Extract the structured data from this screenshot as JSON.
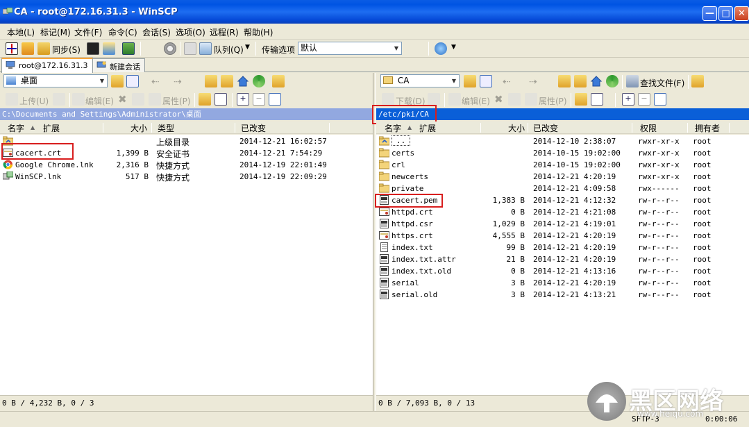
{
  "window": {
    "title": "CA - root@172.16.31.3 - WinSCP"
  },
  "menu": [
    "本地(L)",
    "标记(M)",
    "文件(F)",
    "命令(C)",
    "会话(S)",
    "选项(O)",
    "远程(R)",
    "帮助(H)"
  ],
  "toolbar": {
    "sync_label": "同步(S)",
    "queue_label": "队列(Q)",
    "transfer_label": "传输选项",
    "transfer_value": "默认"
  },
  "tabs": [
    "root@172.16.31.3",
    "新建会话"
  ],
  "left": {
    "drive": "桌面",
    "actions": {
      "upload": "上传(U)",
      "edit": "编辑(E)",
      "props": "属性(P)"
    },
    "path": "C:\\Documents and Settings\\Administrator\\桌面",
    "columns": [
      "名字",
      "扩展",
      "大小",
      "类型",
      "已改变"
    ],
    "rows": [
      {
        "icon": "parent-folder-icon",
        "name": "",
        "size": "",
        "type": "上级目录",
        "changed": "2014-12-21  16:02:57"
      },
      {
        "icon": "certificate-icon",
        "name": "cacert.crt",
        "size": "1,399 B",
        "type": "安全证书",
        "changed": "2014-12-21  7:54:29"
      },
      {
        "icon": "chrome-icon",
        "name": "Google Chrome.lnk",
        "size": "2,316 B",
        "type": "快捷方式",
        "changed": "2014-12-19  22:01:49"
      },
      {
        "icon": "winscp-icon",
        "name": "WinSCP.lnk",
        "size": "517 B",
        "type": "快捷方式",
        "changed": "2014-12-19  22:09:29"
      }
    ],
    "status": "0 B / 4,232 B,  0 / 3"
  },
  "right": {
    "drive": "CA",
    "find_label": "查找文件(F)",
    "actions": {
      "download": "下载(D)",
      "edit": "编辑(E)",
      "props": "属性(P)"
    },
    "path": "/etc/pki/CA",
    "columns": [
      "名字",
      "扩展",
      "大小",
      "已改变",
      "权限",
      "拥有者"
    ],
    "rows": [
      {
        "icon": "parent-folder-icon",
        "name": "..",
        "size": "",
        "changed": "2014-12-10  2:38:07",
        "perm": "rwxr-xr-x",
        "owner": "root"
      },
      {
        "icon": "folder-icon",
        "name": "certs",
        "size": "",
        "changed": "2014-10-15  19:02:00",
        "perm": "rwxr-xr-x",
        "owner": "root"
      },
      {
        "icon": "folder-icon",
        "name": "crl",
        "size": "",
        "changed": "2014-10-15  19:02:00",
        "perm": "rwxr-xr-x",
        "owner": "root"
      },
      {
        "icon": "folder-icon",
        "name": "newcerts",
        "size": "",
        "changed": "2014-12-21  4:20:19",
        "perm": "rwxr-xr-x",
        "owner": "root"
      },
      {
        "icon": "folder-icon",
        "name": "private",
        "size": "",
        "changed": "2014-12-21  4:09:58",
        "perm": "rwx------",
        "owner": "root"
      },
      {
        "icon": "file-icon",
        "name": "cacert.pem",
        "size": "1,383 B",
        "changed": "2014-12-21  4:12:32",
        "perm": "rw-r--r--",
        "owner": "root"
      },
      {
        "icon": "certificate-icon",
        "name": "httpd.crt",
        "size": "0 B",
        "changed": "2014-12-21  4:21:08",
        "perm": "rw-r--r--",
        "owner": "root"
      },
      {
        "icon": "file-icon",
        "name": "httpd.csr",
        "size": "1,029 B",
        "changed": "2014-12-21  4:19:01",
        "perm": "rw-r--r--",
        "owner": "root"
      },
      {
        "icon": "certificate-icon",
        "name": "https.crt",
        "size": "4,555 B",
        "changed": "2014-12-21  4:20:19",
        "perm": "rw-r--r--",
        "owner": "root"
      },
      {
        "icon": "text-file-icon",
        "name": "index.txt",
        "size": "99 B",
        "changed": "2014-12-21  4:20:19",
        "perm": "rw-r--r--",
        "owner": "root"
      },
      {
        "icon": "file-icon",
        "name": "index.txt.attr",
        "size": "21 B",
        "changed": "2014-12-21  4:20:19",
        "perm": "rw-r--r--",
        "owner": "root"
      },
      {
        "icon": "file-icon",
        "name": "index.txt.old",
        "size": "0 B",
        "changed": "2014-12-21  4:13:16",
        "perm": "rw-r--r--",
        "owner": "root"
      },
      {
        "icon": "file-icon",
        "name": "serial",
        "size": "3 B",
        "changed": "2014-12-21  4:20:19",
        "perm": "rw-r--r--",
        "owner": "root"
      },
      {
        "icon": "file-icon",
        "name": "serial.old",
        "size": "3 B",
        "changed": "2014-12-21  4:13:21",
        "perm": "rw-r--r--",
        "owner": "root"
      }
    ],
    "status": "0 B / 7,093 B,  0 / 13",
    "protocol": "SFTP-3",
    "clock": "0:00:06"
  },
  "watermark": {
    "cn": "黑区网络",
    "url": "www.heiqu.com"
  },
  "colors": {
    "title_blue": "#0054e3",
    "left_path_bg": "#92a8e0",
    "right_path_bg": "#0a5fd8",
    "highlight_red": "#d81e1e"
  }
}
